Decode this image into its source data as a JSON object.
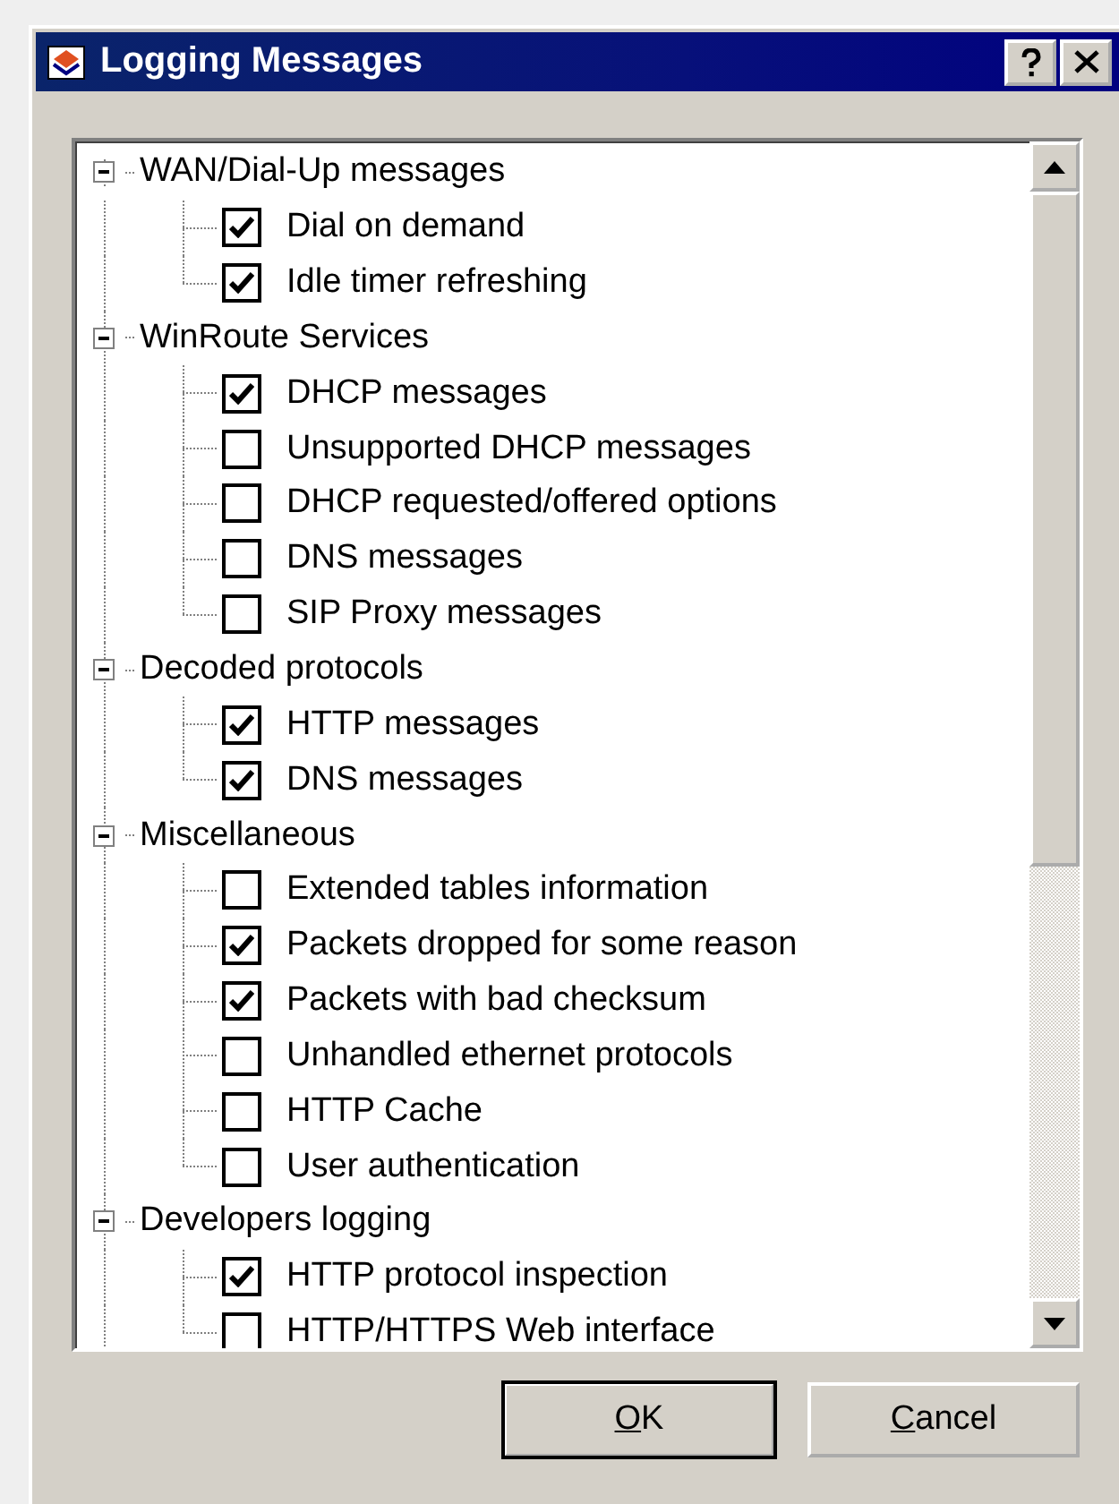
{
  "window": {
    "title": "Logging Messages"
  },
  "groups": [
    {
      "label": "WAN/Dial-Up messages",
      "expanded": true,
      "children": [
        {
          "label": "Dial on demand",
          "checked": true
        },
        {
          "label": "Idle timer refreshing",
          "checked": true
        }
      ]
    },
    {
      "label": "WinRoute Services",
      "expanded": true,
      "children": [
        {
          "label": "DHCP messages",
          "checked": true
        },
        {
          "label": "Unsupported DHCP messages",
          "checked": false
        },
        {
          "label": "DHCP requested/offered options",
          "checked": false
        },
        {
          "label": "DNS messages",
          "checked": false
        },
        {
          "label": "SIP Proxy messages",
          "checked": false
        }
      ]
    },
    {
      "label": "Decoded protocols",
      "expanded": true,
      "children": [
        {
          "label": "HTTP messages",
          "checked": true
        },
        {
          "label": "DNS messages",
          "checked": true
        }
      ]
    },
    {
      "label": "Miscellaneous",
      "expanded": true,
      "children": [
        {
          "label": "Extended tables information",
          "checked": false
        },
        {
          "label": "Packets dropped for some reason",
          "checked": true
        },
        {
          "label": "Packets with bad checksum",
          "checked": true
        },
        {
          "label": "Unhandled ethernet protocols",
          "checked": false
        },
        {
          "label": "HTTP Cache",
          "checked": false
        },
        {
          "label": "User authentication",
          "checked": false
        }
      ]
    },
    {
      "label": "Developers logging",
      "expanded": true,
      "children": [
        {
          "label": "HTTP protocol inspection",
          "checked": true
        },
        {
          "label": "HTTP/HTTPS Web interface",
          "checked": false
        }
      ]
    }
  ],
  "buttons": [
    {
      "label": "OK",
      "default": true
    },
    {
      "label": "Cancel",
      "default": false
    }
  ]
}
